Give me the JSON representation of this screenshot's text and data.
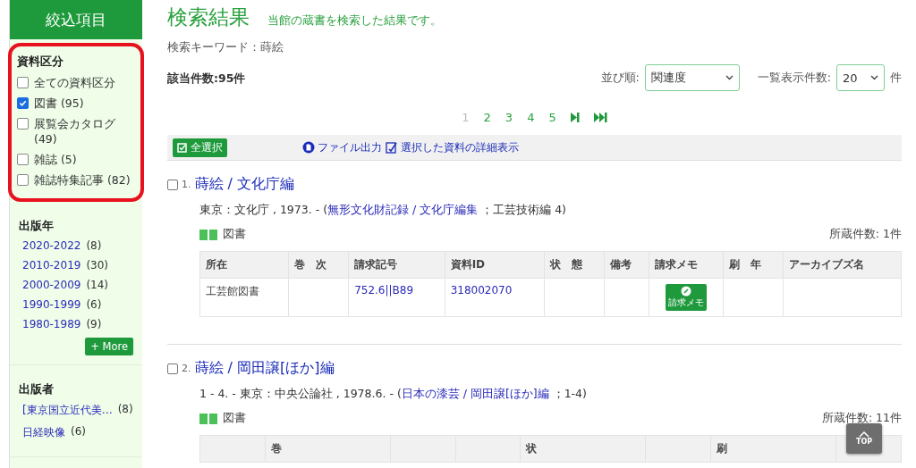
{
  "sidebar": {
    "title": "絞込項目",
    "sections": [
      {
        "heading": "資料区分",
        "kind": "checkbox",
        "highlighted": true,
        "items": [
          {
            "label": "全ての資料区分",
            "checked": false
          },
          {
            "label": "図書",
            "count": "(95)",
            "checked": true
          },
          {
            "label": "展覧会カタログ",
            "count": "(49)",
            "checked": false
          },
          {
            "label": "雑誌",
            "count": "(5)",
            "checked": false
          },
          {
            "label": "雑誌特集記事",
            "count": "(82)",
            "checked": false
          }
        ]
      },
      {
        "heading": "出版年",
        "kind": "link",
        "highlighted": false,
        "more": "+ More",
        "items": [
          {
            "label": "2020-2022",
            "count": "(8)"
          },
          {
            "label": "2010-2019",
            "count": "(30)"
          },
          {
            "label": "2000-2009",
            "count": "(14)"
          },
          {
            "label": "1990-1999",
            "count": "(6)"
          },
          {
            "label": "1980-1989",
            "count": "(9)"
          }
        ]
      },
      {
        "heading": "出版者",
        "kind": "link",
        "highlighted": false,
        "items": [
          {
            "label": "[東京国立近代美…",
            "count": "(8)"
          },
          {
            "label": "日経映像",
            "count": "(6)"
          }
        ]
      }
    ]
  },
  "header": {
    "title": "検索結果",
    "subtitle": "当館の蔵書を検索した結果です。",
    "keyword": "検索キーワード：蒔絵",
    "hits": "該当件数:95件"
  },
  "sort": {
    "label": "並び順:",
    "value": "関連度"
  },
  "per_page": {
    "label": "一覧表示件数:",
    "value": "20",
    "unit": "件"
  },
  "pagination": {
    "pages": [
      {
        "label": "1",
        "selected": true
      },
      {
        "label": "2",
        "selected": false
      },
      {
        "label": "3",
        "selected": false
      },
      {
        "label": "4",
        "selected": false
      },
      {
        "label": "5",
        "selected": false
      }
    ]
  },
  "toolbar": {
    "select_all": "全選択",
    "export": "ファイル出力",
    "details": "選択した資料の詳細表示"
  },
  "records": [
    {
      "number": "1.",
      "checked": false,
      "title": "蒔絵 / 文化庁編",
      "pub": "東京：文化庁 , 1973. - (",
      "series": "無形文化財記録 / 文化庁編集",
      "series_rest": "；工芸技術編 4)",
      "type": "図書",
      "holdings": "所蔵件数: 1件",
      "columns": [
        {
          "label": "所在"
        },
        {
          "label": "巻　次"
        },
        {
          "label": "請求記号"
        },
        {
          "label": "資料ID"
        },
        {
          "label": "状　態"
        },
        {
          "label": "備考"
        },
        {
          "label": "請求メモ"
        },
        {
          "label": "刷　年"
        },
        {
          "label": "アーカイブズ名"
        }
      ],
      "rows": [
        {
          "location": "工芸館図書",
          "call_number": "752.6||B89",
          "id": "318002070",
          "memo": "請求メモ"
        }
      ]
    },
    {
      "number": "2.",
      "checked": false,
      "title": "蒔絵 / 岡田譲[ほか]編",
      "pub": "1 - 4. - 東京：中央公論社 , 1978.6. - (",
      "series": "日本の漆芸 / 岡田譲[ほか]編",
      "series_rest": "；1-4)",
      "type": "図書",
      "holdings": "所蔵件数: 11件",
      "columns": [
        {},
        {
          "label": "巻"
        },
        {},
        {},
        {
          "label": "状"
        },
        {},
        {
          "label": "刷"
        },
        {}
      ]
    }
  ],
  "top_button": "TOP"
}
